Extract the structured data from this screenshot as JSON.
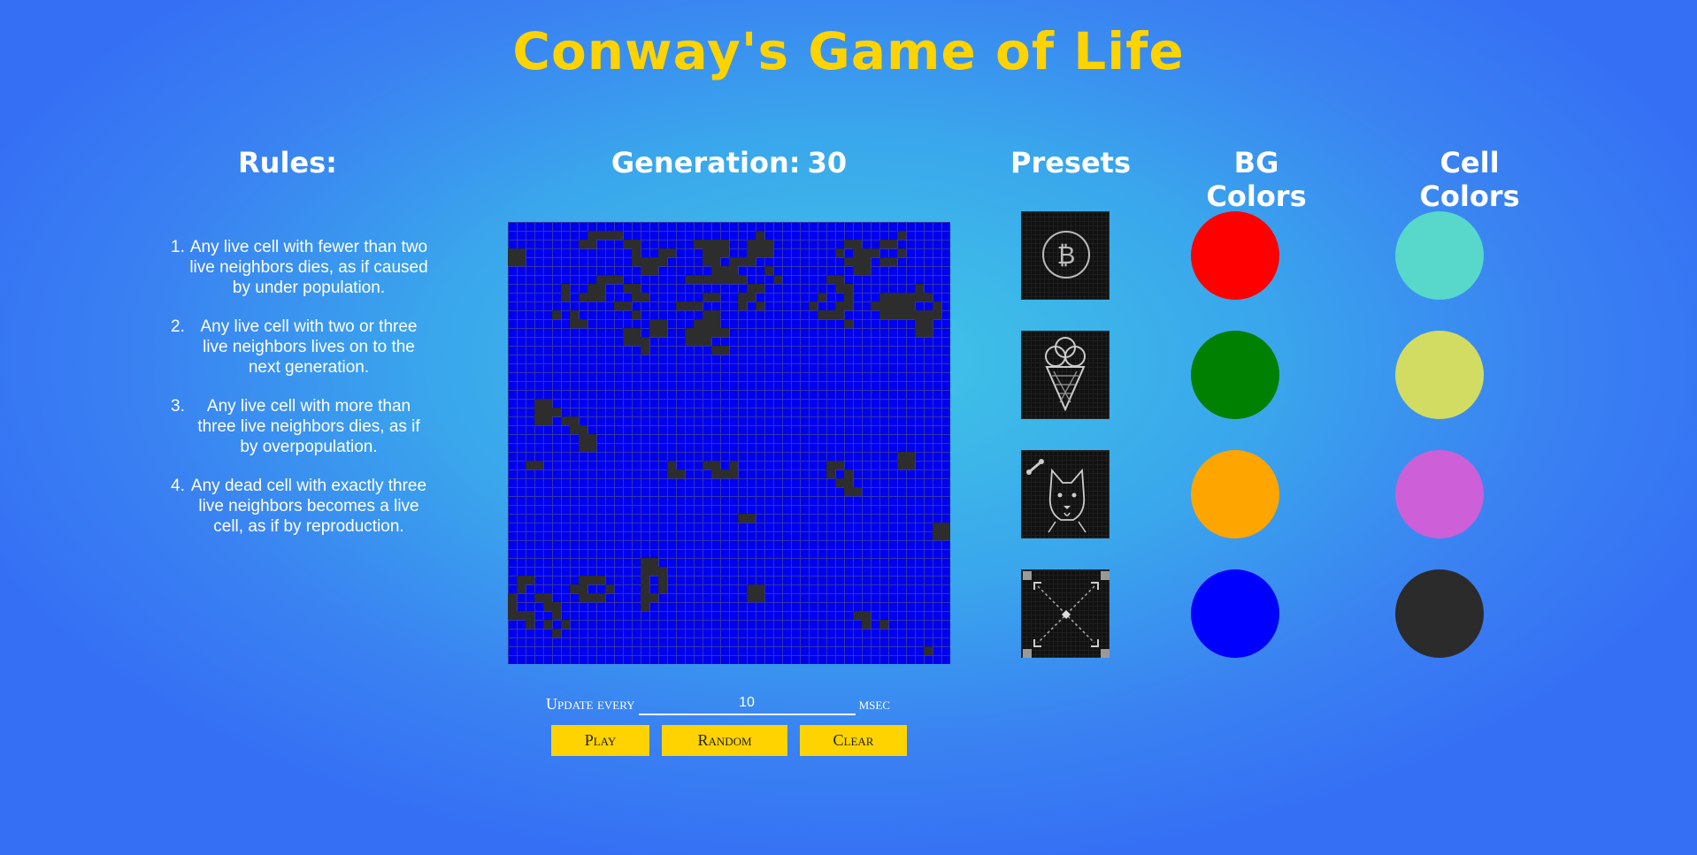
{
  "page": {
    "title": "Conway's Game of Life"
  },
  "rules": {
    "heading": "Rules:",
    "items": [
      {
        "num": "1.",
        "text": "Any live cell with fewer than two live neighbors dies, as if caused by under population."
      },
      {
        "num": "2.",
        "text": "Any live cell with two or three live neighbors lives on to the next generation."
      },
      {
        "num": "3.",
        "text": "Any live cell with more than three live neighbors dies, as if by overpopulation."
      },
      {
        "num": "4.",
        "text": "Any dead cell with exactly three live neighbors becomes a live cell, as if by reproduction."
      }
    ]
  },
  "game": {
    "generation_label": "Generation:",
    "generation_value": "30",
    "bg_color": "#0000ee",
    "cell_color": "#2d2d2d",
    "live_cells": [
      [
        0,
        3
      ],
      [
        0,
        4
      ],
      [
        1,
        3
      ],
      [
        1,
        4
      ],
      [
        8,
        2
      ],
      [
        9,
        2
      ],
      [
        9,
        1
      ],
      [
        10,
        1
      ],
      [
        11,
        1
      ],
      [
        12,
        1
      ],
      [
        13,
        2
      ],
      [
        14,
        2
      ],
      [
        14,
        3
      ],
      [
        15,
        5
      ],
      [
        16,
        5
      ],
      [
        17,
        4
      ],
      [
        20,
        6
      ],
      [
        21,
        6
      ],
      [
        22,
        6
      ],
      [
        23,
        6
      ],
      [
        23,
        5
      ],
      [
        24,
        5
      ],
      [
        25,
        5
      ],
      [
        26,
        4
      ],
      [
        27,
        4
      ],
      [
        28,
        3
      ],
      [
        14,
        4
      ],
      [
        15,
        4
      ],
      [
        16,
        4
      ],
      [
        17,
        3
      ],
      [
        18,
        3
      ],
      [
        10,
        6
      ],
      [
        11,
        6
      ],
      [
        12,
        6
      ],
      [
        9,
        7
      ],
      [
        10,
        7
      ],
      [
        13,
        7
      ],
      [
        14,
        7
      ],
      [
        9,
        8
      ],
      [
        10,
        8
      ],
      [
        14,
        8
      ],
      [
        15,
        8
      ],
      [
        6,
        7
      ],
      [
        6,
        8
      ],
      [
        8,
        8
      ],
      [
        12,
        9
      ],
      [
        13,
        9
      ],
      [
        5,
        10
      ],
      [
        7,
        10
      ],
      [
        7,
        11
      ],
      [
        8,
        11
      ],
      [
        16,
        11
      ],
      [
        17,
        11
      ],
      [
        16,
        12
      ],
      [
        17,
        12
      ],
      [
        14,
        10
      ],
      [
        21,
        2
      ],
      [
        22,
        2
      ],
      [
        23,
        2
      ],
      [
        24,
        2
      ],
      [
        22,
        3
      ],
      [
        23,
        3
      ],
      [
        24,
        3
      ],
      [
        22,
        4
      ],
      [
        23,
        4
      ],
      [
        23,
        5
      ],
      [
        19,
        9
      ],
      [
        20,
        9
      ],
      [
        21,
        9
      ],
      [
        22,
        8
      ],
      [
        23,
        8
      ],
      [
        22,
        10
      ],
      [
        22,
        11
      ],
      [
        23,
        10
      ],
      [
        23,
        11
      ],
      [
        27,
        2
      ],
      [
        28,
        2
      ],
      [
        28,
        1
      ],
      [
        29,
        2
      ],
      [
        29,
        3
      ],
      [
        27,
        3
      ],
      [
        25,
        4
      ],
      [
        24,
        6
      ],
      [
        25,
        6
      ],
      [
        26,
        6
      ],
      [
        27,
        7
      ],
      [
        28,
        7
      ],
      [
        26,
        8
      ],
      [
        27,
        8
      ],
      [
        26,
        9
      ],
      [
        28,
        9
      ],
      [
        29,
        5
      ],
      [
        30,
        6
      ],
      [
        38,
        2
      ],
      [
        39,
        2
      ],
      [
        39,
        3
      ],
      [
        40,
        3
      ],
      [
        40,
        4
      ],
      [
        41,
        3
      ],
      [
        38,
        4
      ],
      [
        37,
        3
      ],
      [
        36,
        6
      ],
      [
        37,
        6
      ],
      [
        37,
        7
      ],
      [
        38,
        7
      ],
      [
        42,
        4
      ],
      [
        43,
        4
      ],
      [
        44,
        3
      ],
      [
        43,
        2
      ],
      [
        44,
        1
      ],
      [
        42,
        2
      ],
      [
        39,
        4
      ],
      [
        39,
        5
      ],
      [
        40,
        5
      ],
      [
        38,
        8
      ],
      [
        37,
        9
      ],
      [
        38,
        9
      ],
      [
        41,
        9
      ],
      [
        42,
        9
      ],
      [
        43,
        9
      ],
      [
        44,
        9
      ],
      [
        45,
        9
      ],
      [
        45,
        10
      ],
      [
        46,
        10
      ],
      [
        47,
        10
      ],
      [
        48,
        10
      ],
      [
        44,
        10
      ],
      [
        43,
        10
      ],
      [
        42,
        10
      ],
      [
        46,
        11
      ],
      [
        47,
        11
      ],
      [
        46,
        12
      ],
      [
        47,
        12
      ],
      [
        48,
        9
      ],
      [
        47,
        8
      ],
      [
        46,
        8
      ],
      [
        45,
        8
      ],
      [
        44,
        8
      ],
      [
        43,
        8
      ],
      [
        42,
        8
      ],
      [
        46,
        7
      ],
      [
        35,
        8
      ],
      [
        34,
        9
      ],
      [
        35,
        10
      ],
      [
        36,
        10
      ],
      [
        37,
        10
      ],
      [
        38,
        11
      ],
      [
        22,
        10
      ],
      [
        21,
        11
      ],
      [
        20,
        12
      ],
      [
        21,
        12
      ],
      [
        20,
        13
      ],
      [
        21,
        13
      ],
      [
        22,
        13
      ],
      [
        22,
        12
      ],
      [
        23,
        12
      ],
      [
        24,
        12
      ],
      [
        23,
        14
      ],
      [
        24,
        14
      ],
      [
        13,
        12
      ],
      [
        14,
        12
      ],
      [
        13,
        13
      ],
      [
        14,
        13
      ],
      [
        15,
        14
      ],
      [
        15,
        13
      ],
      [
        3,
        20
      ],
      [
        4,
        20
      ],
      [
        3,
        21
      ],
      [
        4,
        21
      ],
      [
        5,
        21
      ],
      [
        3,
        22
      ],
      [
        4,
        22
      ],
      [
        6,
        22
      ],
      [
        7,
        22
      ],
      [
        7,
        23
      ],
      [
        8,
        23
      ],
      [
        8,
        24
      ],
      [
        9,
        24
      ],
      [
        8,
        25
      ],
      [
        9,
        25
      ],
      [
        2,
        27
      ],
      [
        3,
        27
      ],
      [
        22,
        27
      ],
      [
        23,
        27
      ],
      [
        23,
        28
      ],
      [
        24,
        28
      ],
      [
        25,
        28
      ],
      [
        25,
        27
      ],
      [
        26,
        33
      ],
      [
        27,
        33
      ],
      [
        18,
        28
      ],
      [
        19,
        28
      ],
      [
        18,
        27
      ],
      [
        36,
        27
      ],
      [
        37,
        27
      ],
      [
        36,
        28
      ],
      [
        38,
        28
      ],
      [
        38,
        29
      ],
      [
        37,
        29
      ],
      [
        38,
        30
      ],
      [
        39,
        30
      ],
      [
        44,
        26
      ],
      [
        45,
        26
      ],
      [
        44,
        27
      ],
      [
        45,
        27
      ],
      [
        48,
        34
      ],
      [
        49,
        34
      ],
      [
        48,
        35
      ],
      [
        49,
        35
      ],
      [
        1,
        40
      ],
      [
        2,
        40
      ],
      [
        1,
        41
      ],
      [
        3,
        42
      ],
      [
        4,
        42
      ],
      [
        5,
        43
      ],
      [
        4,
        43
      ],
      [
        0,
        42
      ],
      [
        0,
        43
      ],
      [
        0,
        44
      ],
      [
        1,
        44
      ],
      [
        5,
        44
      ],
      [
        4,
        45
      ],
      [
        2,
        44
      ],
      [
        2,
        45
      ],
      [
        8,
        40
      ],
      [
        9,
        40
      ],
      [
        10,
        40
      ],
      [
        8,
        41
      ],
      [
        7,
        41
      ],
      [
        11,
        41
      ],
      [
        8,
        42
      ],
      [
        9,
        42
      ],
      [
        10,
        42
      ],
      [
        15,
        38
      ],
      [
        16,
        38
      ],
      [
        15,
        39
      ],
      [
        16,
        39
      ],
      [
        17,
        39
      ],
      [
        15,
        40
      ],
      [
        17,
        40
      ],
      [
        15,
        41
      ],
      [
        17,
        41
      ],
      [
        15,
        42
      ],
      [
        16,
        42
      ],
      [
        15,
        43
      ],
      [
        27,
        41
      ],
      [
        28,
        41
      ],
      [
        27,
        42
      ],
      [
        28,
        42
      ],
      [
        39,
        44
      ],
      [
        40,
        44
      ],
      [
        40,
        45
      ],
      [
        42,
        45
      ],
      [
        47,
        48
      ],
      [
        5,
        44
      ],
      [
        6,
        45
      ],
      [
        5,
        46
      ]
    ]
  },
  "controls": {
    "update_label": "Update every",
    "interval_value": "10",
    "unit_label": "msec",
    "play_label": "Play",
    "random_label": "Random",
    "clear_label": "Clear"
  },
  "presets": {
    "heading": "Presets",
    "items": [
      {
        "name": "bitcoin-preset"
      },
      {
        "name": "ice-cream-preset"
      },
      {
        "name": "dog-preset"
      },
      {
        "name": "arrows-preset"
      }
    ]
  },
  "bg_colors": {
    "heading": "BG Colors",
    "colors": [
      "#ff0000",
      "#008000",
      "#ffa500",
      "#0000ff"
    ]
  },
  "cell_colors": {
    "heading": "Cell Colors",
    "colors": [
      "#57d8cb",
      "#d3dc62",
      "#cd5fd9",
      "#2b2b2b"
    ]
  }
}
